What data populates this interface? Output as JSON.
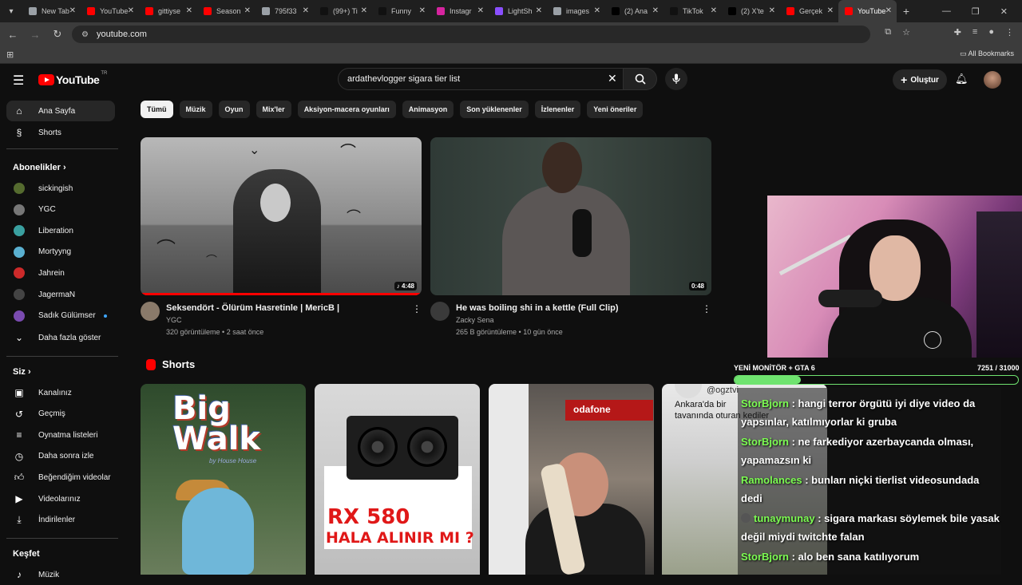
{
  "browser": {
    "tabs": [
      {
        "label": "New Tab",
        "color": "#9aa0a6"
      },
      {
        "label": "YouTube",
        "color": "#ff0000"
      },
      {
        "label": "gittiyse",
        "color": "#ff0000"
      },
      {
        "label": "Season",
        "color": "#ff0000"
      },
      {
        "label": "795f33",
        "color": "#9aa0a6"
      },
      {
        "label": "(99+) Ti",
        "color": "#111111"
      },
      {
        "label": "Funny",
        "color": "#111111"
      },
      {
        "label": "Instagr",
        "color": "#d6249f"
      },
      {
        "label": "LightSh",
        "color": "#8a4fff"
      },
      {
        "label": "images",
        "color": "#9aa0a6"
      },
      {
        "label": "(2) Ana",
        "color": "#000000"
      },
      {
        "label": "TikTok",
        "color": "#111111"
      },
      {
        "label": "(2) X'te",
        "color": "#000000"
      },
      {
        "label": "Gerçek",
        "color": "#ff0000"
      },
      {
        "label": "YouTube",
        "color": "#ff0000",
        "active": true
      }
    ],
    "url": "youtube.com",
    "all_bookmarks": "All Bookmarks"
  },
  "yt": {
    "logo_text": "YouTube",
    "logo_region": "TR",
    "search_value": "ardathevlogger sigara tier list",
    "create_label": "Oluştur"
  },
  "sidebar": {
    "home": "Ana Sayfa",
    "shorts": "Shorts",
    "subscriptions_title": "Abonelikler",
    "channels": [
      {
        "name": "sickingish",
        "color": "#556b2f"
      },
      {
        "name": "YGC",
        "color": "#777777"
      },
      {
        "name": "Liberation",
        "color": "#3aa0a0"
      },
      {
        "name": "Mortyyng",
        "color": "#5ab0d0"
      },
      {
        "name": "Jahrein",
        "color": "#cc2a2a"
      },
      {
        "name": "JagermaN",
        "color": "#444444"
      },
      {
        "name": "Sadık Gülümser",
        "color": "#7a4bb0"
      }
    ],
    "show_more": "Daha fazla göster",
    "you_title": "Siz",
    "you_items": [
      "Kanalınız",
      "Geçmiş",
      "Oynatma listeleri",
      "Daha sonra izle",
      "Beğendiğim videolar",
      "Videolarınız",
      "İndirilenler"
    ],
    "explore_title": "Keşfet",
    "explore_items": [
      "Müzik"
    ]
  },
  "chips": [
    "Tümü",
    "Müzik",
    "Oyun",
    "Mix'ler",
    "Aksiyon-macera oyunları",
    "Animasyon",
    "Son yüklenenler",
    "İzlenenler",
    "Yeni öneriler"
  ],
  "videos": [
    {
      "title": "Seksendört - Ölürüm Hasretinle | MericB |",
      "channel": "YGC",
      "stats": "320 görüntüleme • 2 saat önce",
      "duration": "4:48",
      "watched_fraction": 1.0
    },
    {
      "title": "He was boiling shi in a kettle (Full Clip)",
      "channel": "Zacky Sena",
      "stats": "265 B görüntüleme • 10 gün önce",
      "duration": "0:48"
    }
  ],
  "shorts_section": {
    "title": "Shorts",
    "cards": [
      {
        "line1": "Big",
        "line2": "Walk",
        "sub": "by House House"
      },
      {
        "line1": "RX 580",
        "line2": "HALA ALINIR MI ?"
      },
      {
        "sign": "odafone"
      },
      {
        "handle": "@ogztvi",
        "caption1": "Ankara'da bir",
        "caption2": "tavanında oturan kediler"
      }
    ]
  },
  "stream": {
    "goal_label": "YENİ MONİTÖR + GTA 6",
    "goal_count": "7251 / 31000",
    "goal_fraction": 0.234,
    "chat": [
      {
        "user": "StorBjorn",
        "text": "hangi terror örgütü iyi diye video da yapsınlar, katılmıyorlar ki gruba"
      },
      {
        "user": "StorBjorn",
        "text": "ne farkediyor azerbaycanda olması, yapamazsın ki"
      },
      {
        "user": "Ramolances",
        "text": "bunları niçki tierlist videosundada dedi"
      },
      {
        "user": "tunaymunay",
        "text": "sigara markası söylemek bile yasak değil miydi twitchte falan"
      },
      {
        "user": "StorBjorn",
        "text": "alo ben sana katılıyorum"
      }
    ]
  }
}
